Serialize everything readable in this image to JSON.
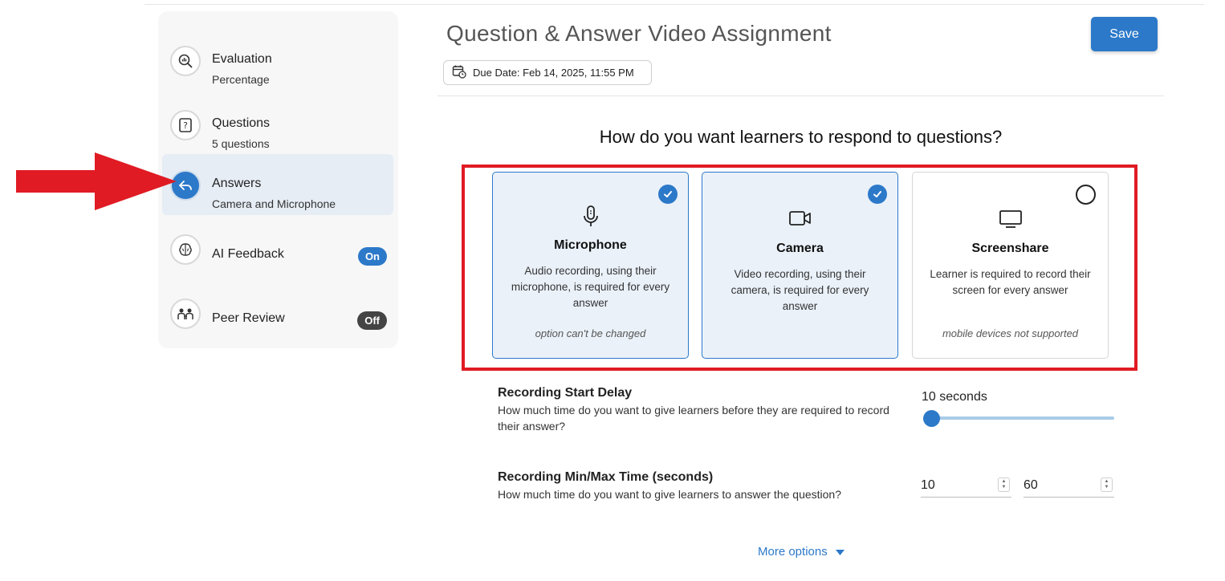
{
  "sidebar": {
    "items": [
      {
        "title": "Evaluation",
        "subtitle": "Percentage",
        "icon": "magnifier-chart-icon"
      },
      {
        "title": "Questions",
        "subtitle": "5 questions",
        "icon": "question-box-icon"
      },
      {
        "title": "Answers",
        "subtitle": "Camera and Microphone",
        "icon": "reply-arrow-icon",
        "active": true
      },
      {
        "title": "AI Feedback",
        "badge": "On",
        "icon": "brain-icon"
      },
      {
        "title": "Peer Review",
        "badge": "Off",
        "icon": "people-icon"
      }
    ]
  },
  "header": {
    "title": "Question & Answer Video Assignment",
    "save_label": "Save",
    "due_date": "Due Date: Feb 14, 2025, 11:55 PM"
  },
  "main": {
    "question": "How do you want learners to respond to questions?",
    "cards": [
      {
        "title": "Microphone",
        "description": "Audio recording, using their microphone, is required for every answer",
        "note": "option can't be changed",
        "selected": true,
        "icon": "microphone-icon"
      },
      {
        "title": "Camera",
        "description": "Video recording, using their camera, is required for every answer",
        "note": "",
        "selected": true,
        "icon": "camera-icon"
      },
      {
        "title": "Screenshare",
        "description": "Learner is required to record their screen for every answer",
        "note": "mobile devices not supported",
        "selected": false,
        "icon": "monitor-icon"
      }
    ],
    "start_delay": {
      "title": "Recording Start Delay",
      "description": "How much time do you want to give learners before they are required to record their answer?",
      "value_label": "10 seconds",
      "level": 0
    },
    "min_max": {
      "title": "Recording Min/Max Time (seconds)",
      "description": "How much time do you want to give learners to answer the question?",
      "min": "10",
      "max": "60"
    },
    "more_options": "More options"
  },
  "colors": {
    "accent": "#2c79c9",
    "highlight": "#e01b24",
    "arrow": "#e01b24"
  }
}
